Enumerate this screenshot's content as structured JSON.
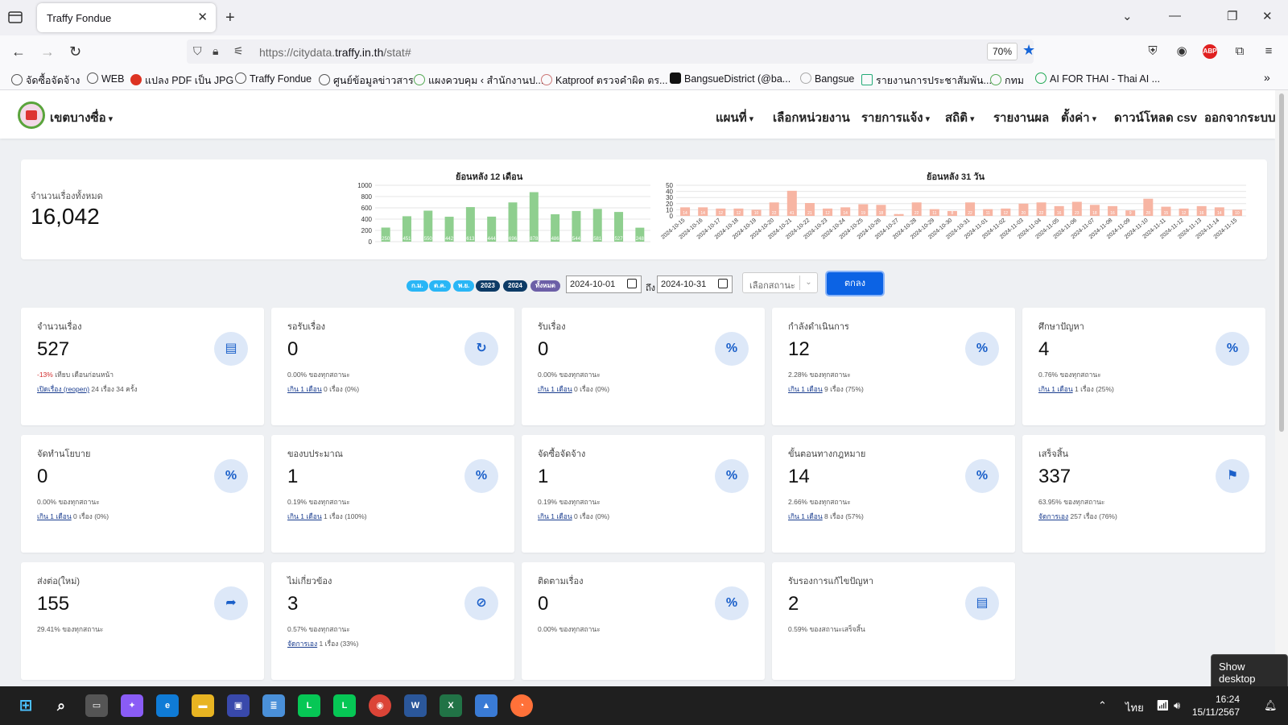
{
  "browser": {
    "tab_title": "Traffy Fondue",
    "url_prefix": "https://citydata.",
    "url_domain": "traffy.in.th",
    "url_suffix": "/stat#",
    "zoom": "70%",
    "bookmarks": [
      "จัดซื้อจัดจ้าง",
      "WEB",
      "แปลง PDF เป็น JPG",
      "Traffy Fondue",
      "ศูนย์ข้อมูลข่าวสาร",
      "แผงควบคุม ‹ สำนักงานป...",
      "Katproof ตรวจคำผิด ตร...",
      "BangsueDistrict (@ba...",
      "Bangsue",
      "รายงานการประชาสัมพัน...",
      "กทม",
      "AI FOR THAI - Thai AI ..."
    ]
  },
  "app": {
    "district": "เขตบางซื่อ",
    "menu": [
      "แผนที่",
      "เลือกหน่วยงาน",
      "รายการแจ้ง",
      "สถิติ",
      "รายงานผล",
      "ตั้งค่า",
      "ดาวน์โหลด csv",
      "ออกจากระบบ"
    ]
  },
  "summary": {
    "total_label": "จำนวนเรื่องทั้งหมด",
    "total_value": "16,042",
    "chart12_title": "ย้อนหลัง 12 เดือน",
    "chart31_title": "ย้อนหลัง 31 วัน"
  },
  "chart_data": [
    {
      "type": "bar",
      "title": "ย้อนหลัง 12 เดือน",
      "ylim": [
        0,
        1000
      ],
      "yticks": [
        0,
        200,
        400,
        600,
        800,
        1000
      ],
      "values": [
        250,
        451,
        550,
        442,
        613,
        444,
        696,
        878,
        486,
        544,
        581,
        527,
        248
      ],
      "color": "#8fcf8f"
    },
    {
      "type": "bar",
      "title": "ย้อนหลัง 31 วัน",
      "ylim": [
        0,
        50
      ],
      "yticks": [
        0,
        10,
        20,
        30,
        40,
        50
      ],
      "categories": [
        "2024-10-15",
        "2024-10-16",
        "2024-10-17",
        "2024-10-18",
        "2024-10-19",
        "2024-10-20",
        "2024-10-21",
        "2024-10-22",
        "2024-10-23",
        "2024-10-24",
        "2024-10-25",
        "2024-10-26",
        "2024-10-27",
        "2024-10-28",
        "2024-10-29",
        "2024-10-30",
        "2024-10-31",
        "2024-11-01",
        "2024-11-02",
        "2024-11-03",
        "2024-11-04",
        "2024-11-05",
        "2024-11-06",
        "2024-11-07",
        "2024-11-08",
        "2024-11-09",
        "2024-11-10",
        "2024-11-11",
        "2024-11-12",
        "2024-11-13",
        "2024-11-14",
        "2024-11-15"
      ],
      "values": [
        14,
        14,
        12,
        12,
        10,
        22,
        41,
        21,
        12,
        14,
        19,
        18,
        3,
        22,
        11,
        8,
        22,
        11,
        12,
        20,
        22,
        16,
        23,
        18,
        16,
        9,
        28,
        15,
        12,
        16,
        14,
        10
      ],
      "color": "#f7b5a3"
    }
  ],
  "filters": {
    "pills": [
      {
        "label": "ก.ม.",
        "color": "#29b6f6"
      },
      {
        "label": "ต.ค.",
        "color": "#29b6f6"
      },
      {
        "label": "พ.ย.",
        "color": "#29b6f6"
      },
      {
        "label": "2023",
        "color": "#0d3b66"
      },
      {
        "label": "2024",
        "color": "#0d3b66"
      },
      {
        "label": "ทั้งหมด",
        "color": "#6c5fa7"
      }
    ],
    "date_from": "2024-10-01",
    "to_label": "ถึง",
    "date_to": "2024-10-31",
    "status_placeholder": "เลือกสถานะ",
    "ok_label": "ตกลง"
  },
  "cards": [
    {
      "title": "จำนวนเรื่อง",
      "value": "527",
      "sub_red": "-13%",
      "sub": " เทียบ เดือนก่อนหน้า",
      "sub2_link": "เปิดเรื่อง (reopen)",
      "sub2": " 24 เรื่อง 34 ครั้ง",
      "icon": "document-icon",
      "glyph": "▤"
    },
    {
      "title": "รอรับเรื่อง",
      "value": "0",
      "sub_red": "",
      "sub": "0.00% ของทุกสถานะ",
      "sub2_link": "เกิน 1 เดือน",
      "sub2": " 0 เรื่อง (0%)",
      "icon": "refresh-icon",
      "glyph": "↻"
    },
    {
      "title": "รับเรื่อง",
      "value": "0",
      "sub_red": "",
      "sub": "0.00% ของทุกสถานะ",
      "sub2_link": "เกิน 1 เดือน",
      "sub2": " 0 เรื่อง (0%)",
      "icon": "percent-icon",
      "glyph": "%"
    },
    {
      "title": "กำลังดำเนินการ",
      "value": "12",
      "sub_red": "",
      "sub": "2.28% ของทุกสถานะ",
      "sub2_link": "เกิน 1 เดือน",
      "sub2": " 9 เรื่อง (75%)",
      "icon": "percent-icon",
      "glyph": "%"
    },
    {
      "title": "ศึกษาปัญหา",
      "value": "4",
      "sub_red": "",
      "sub": "0.76% ของทุกสถานะ",
      "sub2_link": "เกิน 1 เดือน",
      "sub2": " 1 เรื่อง (25%)",
      "icon": "percent-icon",
      "glyph": "%"
    },
    {
      "title": "จัดทำนโยบาย",
      "value": "0",
      "sub_red": "",
      "sub": "0.00% ของทุกสถานะ",
      "sub2_link": "เกิน 1 เดือน",
      "sub2": " 0 เรื่อง (0%)",
      "icon": "percent-icon",
      "glyph": "%"
    },
    {
      "title": "ของบประมาณ",
      "value": "1",
      "sub_red": "",
      "sub": "0.19% ของทุกสถานะ",
      "sub2_link": "เกิน 1 เดือน",
      "sub2": " 1 เรื่อง (100%)",
      "icon": "percent-icon",
      "glyph": "%"
    },
    {
      "title": "จัดซื้อจัดจ้าง",
      "value": "1",
      "sub_red": "",
      "sub": "0.19% ของทุกสถานะ",
      "sub2_link": "เกิน 1 เดือน",
      "sub2": " 0 เรื่อง (0%)",
      "icon": "percent-icon",
      "glyph": "%"
    },
    {
      "title": "ขั้นตอนทางกฎหมาย",
      "value": "14",
      "sub_red": "",
      "sub": "2.66% ของทุกสถานะ",
      "sub2_link": "เกิน 1 เดือน",
      "sub2": " 8 เรื่อง (57%)",
      "icon": "percent-icon",
      "glyph": "%"
    },
    {
      "title": "เสร็จสิ้น",
      "value": "337",
      "sub_red": "",
      "sub": "63.95% ของทุกสถานะ",
      "sub2_link": "จัดการเอง",
      "sub2": " 257 เรื่อง (76%)",
      "icon": "checkered-flag-icon",
      "glyph": "⚑"
    },
    {
      "title": "ส่งต่อ(ใหม่)",
      "value": "155",
      "sub_red": "",
      "sub": "29.41% ของทุกสถานะ",
      "sub2_link": "",
      "sub2": "",
      "icon": "forward-icon",
      "glyph": "➦"
    },
    {
      "title": "ไม่เกี่ยวข้อง",
      "value": "3",
      "sub_red": "",
      "sub": "0.57% ของทุกสถานะ",
      "sub2_link": "จัดการเอง",
      "sub2": " 1 เรื่อง (33%)",
      "icon": "not-related-icon",
      "glyph": "⊘"
    },
    {
      "title": "ติดตามเรื่อง",
      "value": "0",
      "sub_red": "",
      "sub": "0.00% ของทุกสถานะ",
      "sub2_link": "",
      "sub2": "",
      "icon": "percent-icon",
      "glyph": "%"
    },
    {
      "title": "รับรองการแก้ไขปัญหา",
      "value": "2",
      "sub_red": "",
      "sub": "0.59% ของสถานะเสร็จสิ้น",
      "sub2_link": "",
      "sub2": "",
      "icon": "document-icon",
      "glyph": "▤"
    }
  ],
  "tooltip": "Show desktop",
  "taskbar": {
    "language": "ไทย",
    "time": "16:24",
    "date": "15/11/2567"
  }
}
